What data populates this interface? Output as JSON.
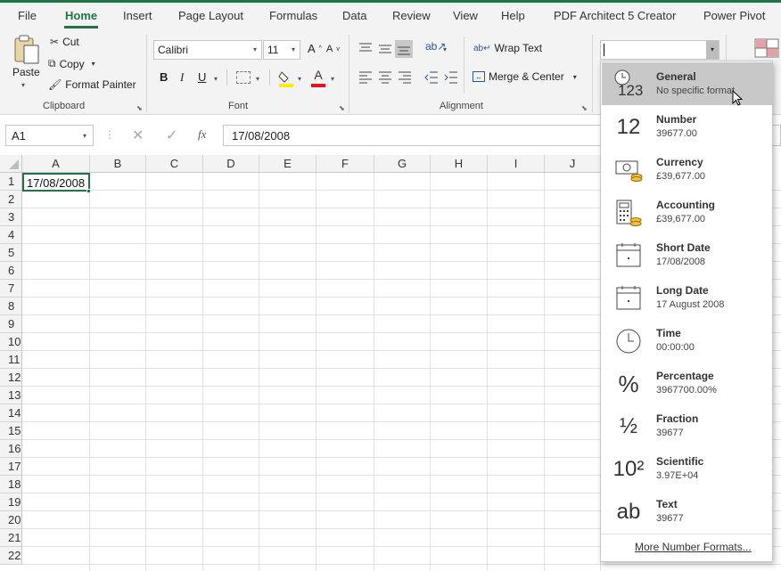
{
  "menu": {
    "tabs": [
      "File",
      "Home",
      "Insert",
      "Page Layout",
      "Formulas",
      "Data",
      "Review",
      "View",
      "Help",
      "PDF Architect 5 Creator",
      "Power Pivot"
    ],
    "active": "Home"
  },
  "clipboard": {
    "paste": "Paste",
    "cut": "Cut",
    "copy": "Copy",
    "format_painter": "Format Painter",
    "label": "Clipboard"
  },
  "font": {
    "name": "Calibri",
    "size": "11",
    "bold": "B",
    "italic": "I",
    "underline": "U",
    "grow": "A",
    "shrink": "A",
    "color_letter": "A",
    "label": "Font",
    "fill_color": "#ffeb00",
    "font_color": "#e81123"
  },
  "alignment": {
    "wrap_text": "Wrap Text",
    "merge_center": "Merge & Center",
    "label": "Alignment"
  },
  "formula_bar": {
    "name_box": "A1",
    "fx": "fx",
    "value": "17/08/2008"
  },
  "sheet": {
    "columns": [
      "A",
      "B",
      "C",
      "D",
      "E",
      "F",
      "G",
      "H",
      "I",
      "J"
    ],
    "rows": [
      "1",
      "2",
      "3",
      "4",
      "5",
      "6",
      "7",
      "8",
      "9",
      "10",
      "11",
      "12",
      "13",
      "14",
      "15",
      "16",
      "17",
      "18",
      "19",
      "20",
      "21",
      "22"
    ],
    "a1": "17/08/2008"
  },
  "number_format": {
    "box_value": "",
    "items": [
      {
        "name": "General",
        "example": "No specific format",
        "icon": "clock-123-icon",
        "glyph": "123"
      },
      {
        "name": "Number",
        "example": "39677.00",
        "icon": "number-12-icon",
        "glyph": "12"
      },
      {
        "name": "Currency",
        "example": "£39,677.00",
        "icon": "currency-icon",
        "glyph": ""
      },
      {
        "name": "Accounting",
        "example": " £39,677.00",
        "icon": "accounting-icon",
        "glyph": ""
      },
      {
        "name": "Short Date",
        "example": "17/08/2008",
        "icon": "calendar-icon",
        "glyph": ""
      },
      {
        "name": "Long Date",
        "example": "17 August 2008",
        "icon": "calendar-icon",
        "glyph": ""
      },
      {
        "name": "Time",
        "example": "00:00:00",
        "icon": "clock-icon",
        "glyph": ""
      },
      {
        "name": "Percentage",
        "example": "3967700.00%",
        "icon": "percent-icon",
        "glyph": "%"
      },
      {
        "name": "Fraction",
        "example": "39677",
        "icon": "fraction-icon",
        "glyph": "½"
      },
      {
        "name": "Scientific",
        "example": "3.97E+04",
        "icon": "scientific-icon",
        "glyph": "10²"
      },
      {
        "name": "Text",
        "example": "39677",
        "icon": "text-ab-icon",
        "glyph": "ab"
      }
    ],
    "more": "More Number Formats...",
    "selected_index": 0
  },
  "colors": {
    "accent": "#217346",
    "ribbon_bg": "#f3f3f3",
    "selected_item": "#c8c8c8"
  }
}
